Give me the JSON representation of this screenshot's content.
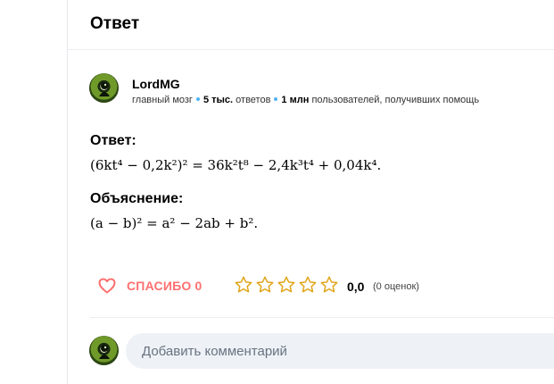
{
  "header": {
    "title": "Ответ"
  },
  "author": {
    "name": "LordMG",
    "rank": "главный мозг",
    "answers_count": "5 тыс.",
    "answers_label": "ответов",
    "helped_count": "1 млн",
    "helped_label": "пользователей, получивших помощь"
  },
  "answer": {
    "answer_label": "Ответ:",
    "answer_formula": "(6kt⁴ − 0,2k²)² = 36k²t⁸ − 2,4k³t⁴ + 0,04k⁴.",
    "explanation_label": "Объяснение:",
    "explanation_formula": "(a − b)² = a² − 2ab + b²."
  },
  "actions": {
    "thanks_label": "СПАСИБО 0",
    "rating_value": "0,0",
    "rating_count": "(0 оценок)",
    "stars_total": 5,
    "stars_filled": 0
  },
  "comment": {
    "placeholder": "Добавить комментарий"
  },
  "colors": {
    "accent_heart": "#ff7070",
    "star_outline": "#e0a418",
    "dot": "#4fb3f6"
  }
}
